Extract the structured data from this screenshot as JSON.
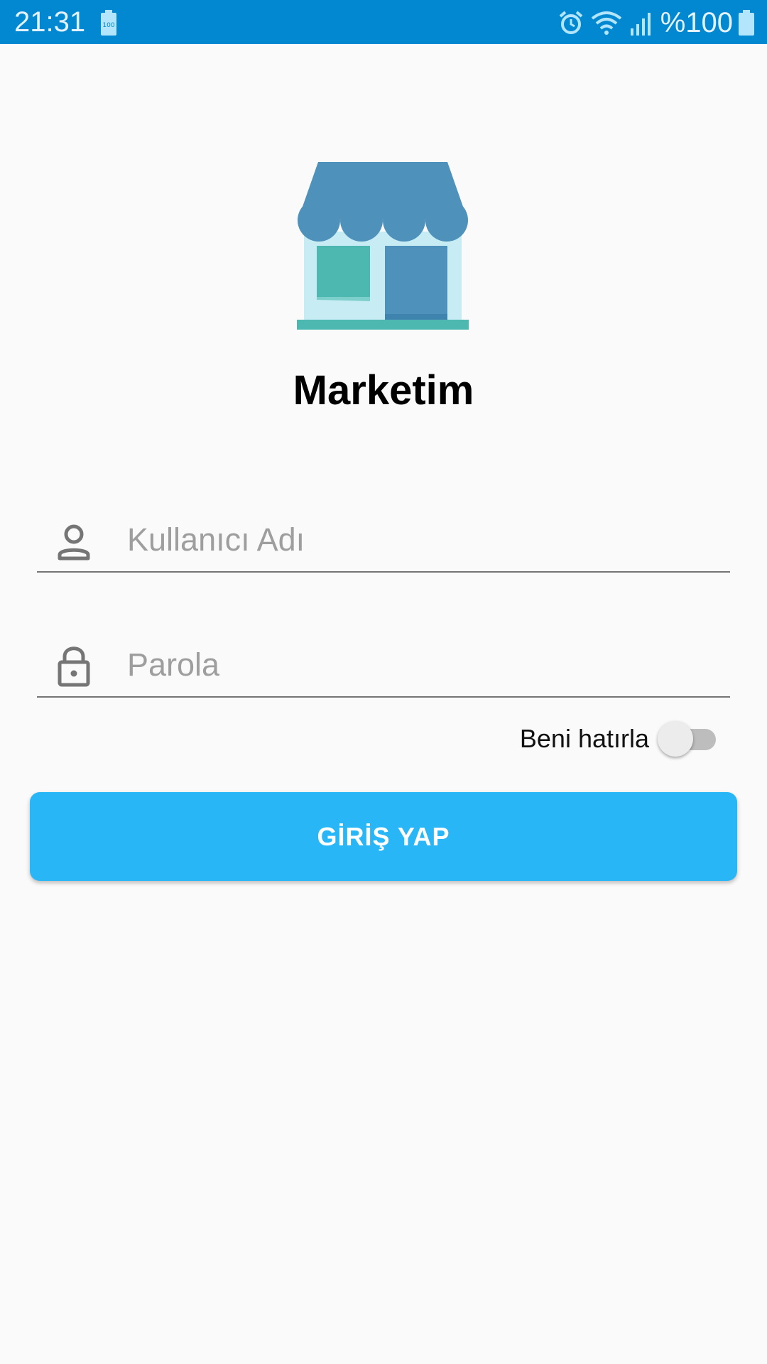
{
  "status_bar": {
    "time": "21:31",
    "battery_text": "%100",
    "icons": [
      "battery-saver-icon",
      "alarm-icon",
      "wifi-icon",
      "signal-icon",
      "battery-icon"
    ]
  },
  "app": {
    "title": "Marketim",
    "logo_icon": "store-icon"
  },
  "form": {
    "username": {
      "value": "",
      "placeholder": "Kullanıcı Adı",
      "icon": "person-icon"
    },
    "password": {
      "value": "",
      "placeholder": "Parola",
      "icon": "lock-icon"
    },
    "remember_label": "Beni hatırla",
    "remember_on": false,
    "login_label": "GİRİŞ YAP"
  },
  "colors": {
    "status_bar": "#0288D1",
    "accent": "#29B6F6",
    "background": "#FAFAFA",
    "logo_awning": "#4E91BA",
    "logo_wall": "#C7ECF4",
    "logo_window": "#4DB8B0"
  }
}
